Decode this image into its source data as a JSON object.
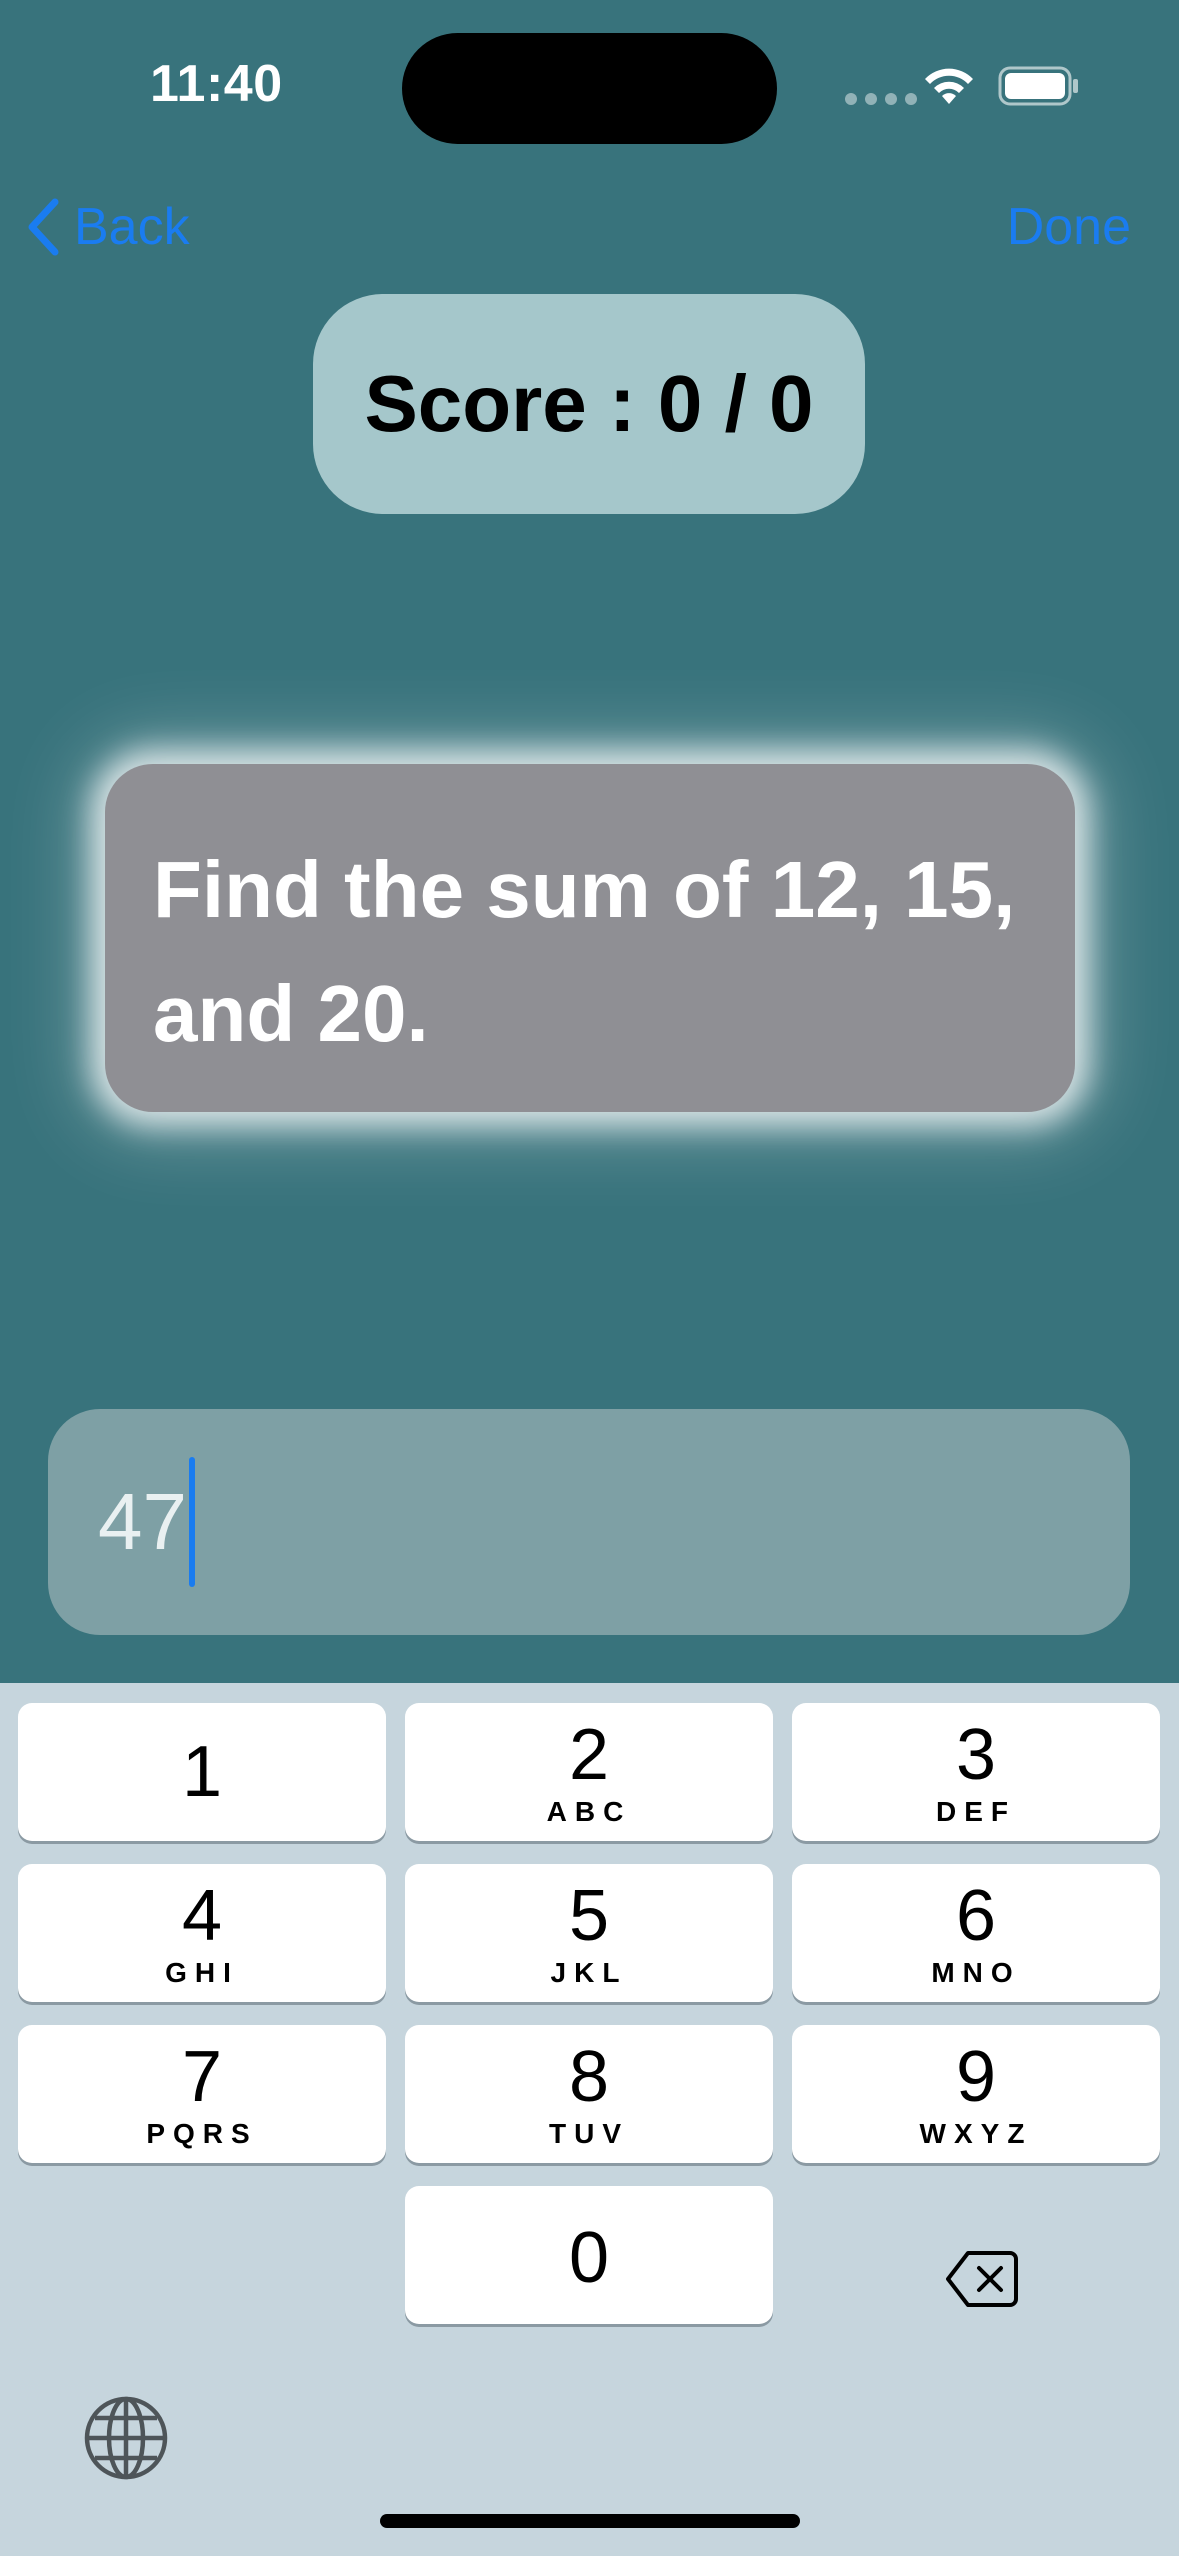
{
  "status_bar": {
    "time": "11:40"
  },
  "nav": {
    "back_label": "Back",
    "done_label": "Done"
  },
  "score": {
    "text": "Score : 0 / 0"
  },
  "question": {
    "text": "Find the sum of 12, 15, and 20."
  },
  "answer": {
    "value": "47"
  },
  "keyboard": {
    "keys": [
      {
        "num": "1",
        "letters": ""
      },
      {
        "num": "2",
        "letters": "ABC"
      },
      {
        "num": "3",
        "letters": "DEF"
      },
      {
        "num": "4",
        "letters": "GHI"
      },
      {
        "num": "5",
        "letters": "JKL"
      },
      {
        "num": "6",
        "letters": "MNO"
      },
      {
        "num": "7",
        "letters": "PQRS"
      },
      {
        "num": "8",
        "letters": "TUV"
      },
      {
        "num": "9",
        "letters": "WXYZ"
      },
      {
        "num": "0",
        "letters": ""
      }
    ]
  },
  "colors": {
    "background": "#38737c",
    "accent": "#1a7cf0",
    "score_pill": "#a5c7cb",
    "question_card": "#8f8f94",
    "answer_field": "#7ea0a5",
    "keyboard_bg": "#c6d5dd"
  },
  "icons": [
    "wifi-icon",
    "battery-icon",
    "chevron-left-icon",
    "delete-icon",
    "globe-icon"
  ]
}
